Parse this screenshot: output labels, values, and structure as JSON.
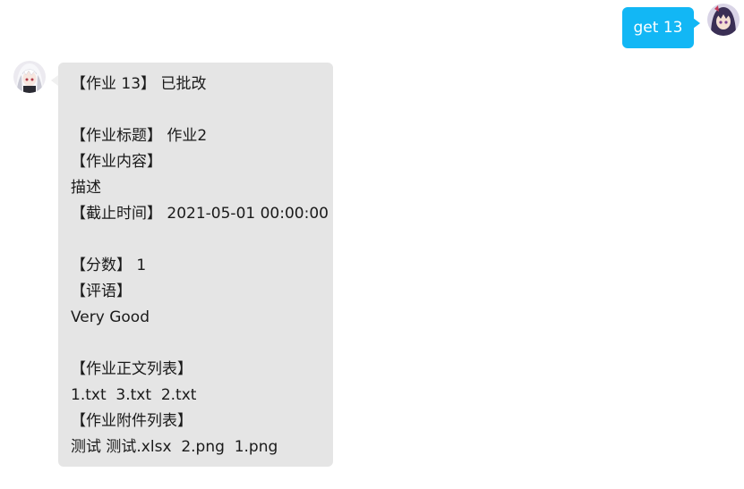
{
  "conversation": {
    "user_message": "get 13",
    "bot_reply": {
      "lines": [
        "【作业 13】 已批改",
        "",
        "【作业标题】 作业2",
        "【作业内容】",
        "描述",
        "【截止时间】 2021-05-01 00:00:00",
        "",
        "【分数】 1",
        "【评语】",
        "Very Good",
        "",
        "【作业正文列表】",
        "1.txt  3.txt  2.txt",
        "【作业附件列表】",
        "测试 测试.xlsx  2.png  1.png"
      ]
    }
  },
  "colors": {
    "user_bubble": "#12b7f5",
    "bot_bubble": "#e5e5e5",
    "background": "#ffffff"
  },
  "icons": {
    "user_avatar": "anime-girl-purple-hair-avatar",
    "bot_avatar": "anime-girl-white-hair-avatar"
  }
}
